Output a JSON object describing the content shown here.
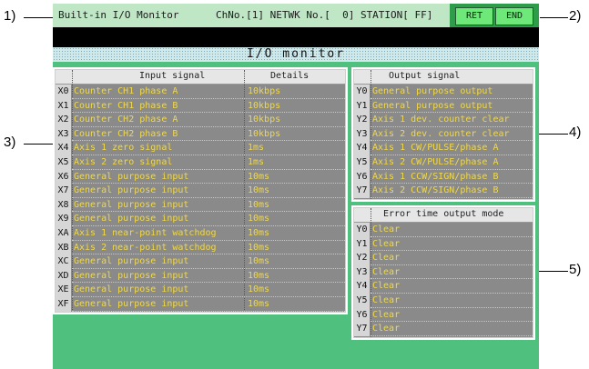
{
  "callouts": [
    "1)",
    "2)",
    "3)",
    "4)",
    "5)"
  ],
  "header": {
    "title": "Built-in I/O Monitor",
    "info": "ChNo.[1] NETWK No.[  0] STATION[ FF]",
    "ret_label": "RET",
    "end_label": "END"
  },
  "banner_title": "I/O monitor",
  "input_panel": {
    "col_signal": "Input signal",
    "col_details": "Details",
    "rows": [
      {
        "addr": "X0",
        "signal": "Counter CH1 phase A",
        "detail": "10kbps"
      },
      {
        "addr": "X1",
        "signal": "Counter CH1 phase B",
        "detail": "10kbps"
      },
      {
        "addr": "X2",
        "signal": "Counter CH2 phase A",
        "detail": "10kbps"
      },
      {
        "addr": "X3",
        "signal": "Counter CH2 phase B",
        "detail": "10kbps"
      },
      {
        "addr": "X4",
        "signal": "Axis 1 zero signal",
        "detail": "1ms"
      },
      {
        "addr": "X5",
        "signal": "Axis 2 zero signal",
        "detail": "1ms"
      },
      {
        "addr": "X6",
        "signal": "General purpose input",
        "detail": "10ms"
      },
      {
        "addr": "X7",
        "signal": "General purpose input",
        "detail": "10ms"
      },
      {
        "addr": "X8",
        "signal": "General purpose input",
        "detail": "10ms"
      },
      {
        "addr": "X9",
        "signal": "General purpose input",
        "detail": "10ms"
      },
      {
        "addr": "XA",
        "signal": "Axis 1 near-point watchdog",
        "detail": "10ms"
      },
      {
        "addr": "XB",
        "signal": "Axis 2 near-point watchdog",
        "detail": "10ms"
      },
      {
        "addr": "XC",
        "signal": "General purpose input",
        "detail": "10ms"
      },
      {
        "addr": "XD",
        "signal": "General purpose input",
        "detail": "10ms"
      },
      {
        "addr": "XE",
        "signal": "General purpose input",
        "detail": "10ms"
      },
      {
        "addr": "XF",
        "signal": "General purpose input",
        "detail": "10ms"
      }
    ]
  },
  "output_panel": {
    "col_signal": "Output signal",
    "rows": [
      {
        "addr": "Y0",
        "signal": "General purpose output"
      },
      {
        "addr": "Y1",
        "signal": "General purpose output"
      },
      {
        "addr": "Y2",
        "signal": "Axis 1 dev. counter clear"
      },
      {
        "addr": "Y3",
        "signal": "Axis 2 dev. counter clear"
      },
      {
        "addr": "Y4",
        "signal": "Axis 1 CW/PULSE/phase A"
      },
      {
        "addr": "Y5",
        "signal": "Axis 2 CW/PULSE/phase A"
      },
      {
        "addr": "Y6",
        "signal": "Axis 1 CCW/SIGN/phase B"
      },
      {
        "addr": "Y7",
        "signal": "Axis 2 CCW/SIGN/phase B"
      }
    ]
  },
  "error_panel": {
    "col_mode": "Error time output mode",
    "rows": [
      {
        "addr": "Y0",
        "mode": "Clear"
      },
      {
        "addr": "Y1",
        "mode": "Clear"
      },
      {
        "addr": "Y2",
        "mode": "Clear"
      },
      {
        "addr": "Y3",
        "mode": "Clear"
      },
      {
        "addr": "Y4",
        "mode": "Clear"
      },
      {
        "addr": "Y5",
        "mode": "Clear"
      },
      {
        "addr": "Y6",
        "mode": "Clear"
      },
      {
        "addr": "Y7",
        "mode": "Clear"
      }
    ]
  },
  "colors": {
    "screen_bg": "#4fc07e",
    "button": "#6fe87a",
    "value_text": "#f0d84a",
    "panel_bg": "#8a8a8a"
  }
}
